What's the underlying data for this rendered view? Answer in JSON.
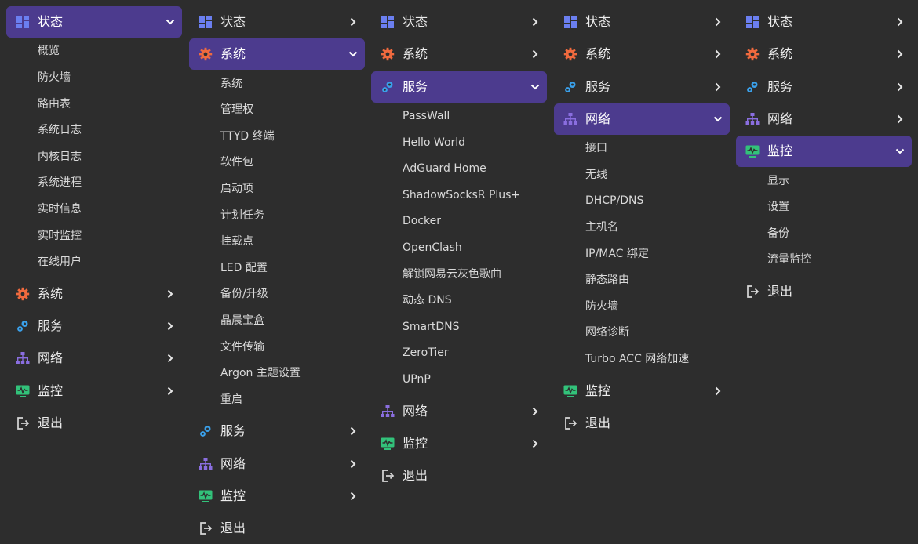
{
  "colors": {
    "background": "#2d2d2d",
    "active": "#4c3b8e",
    "dashboard_icon": "#6b7ff0",
    "gear_icon": "#f06a3e",
    "service_icon": "#3aa0ea",
    "network_icon": "#8a6ee0",
    "monitor_icon": "#32c27a"
  },
  "icons": [
    "dashboard-icon",
    "gear-icon",
    "service-icon",
    "network-icon",
    "monitor-icon",
    "logout-icon",
    "chevron-right-icon",
    "chevron-down-icon"
  ],
  "columns": [
    {
      "status": "状态",
      "system": "系统",
      "service": "服务",
      "network": "网络",
      "monitor": "监控",
      "logout": "退出",
      "expanded": "status",
      "submenu": [
        "概览",
        "防火墙",
        "路由表",
        "系统日志",
        "内核日志",
        "系统进程",
        "实时信息",
        "实时监控",
        "在线用户"
      ]
    },
    {
      "status": "状态",
      "system": "系统",
      "service": "服务",
      "network": "网络",
      "monitor": "监控",
      "logout": "退出",
      "expanded": "system",
      "submenu": [
        "系统",
        "管理权",
        "TTYD 终端",
        "软件包",
        "启动项",
        "计划任务",
        "挂载点",
        "LED 配置",
        "备份/升级",
        "晶晨宝盒",
        "文件传输",
        "Argon 主题设置",
        "重启"
      ]
    },
    {
      "status": "状态",
      "system": "系统",
      "service": "服务",
      "network": "网络",
      "monitor": "监控",
      "logout": "退出",
      "expanded": "service",
      "submenu": [
        "PassWall",
        "Hello World",
        "AdGuard Home",
        "ShadowSocksR Plus+",
        "Docker",
        "OpenClash",
        "解锁网易云灰色歌曲",
        "动态 DNS",
        "SmartDNS",
        "ZeroTier",
        "UPnP"
      ]
    },
    {
      "status": "状态",
      "system": "系统",
      "service": "服务",
      "network": "网络",
      "monitor": "监控",
      "logout": "退出",
      "expanded": "network",
      "submenu": [
        "接口",
        "无线",
        "DHCP/DNS",
        "主机名",
        "IP/MAC 绑定",
        "静态路由",
        "防火墙",
        "网络诊断",
        "Turbo ACC 网络加速"
      ]
    },
    {
      "status": "状态",
      "system": "系统",
      "service": "服务",
      "network": "网络",
      "monitor": "监控",
      "logout": "退出",
      "expanded": "monitor",
      "submenu": [
        "显示",
        "设置",
        "备份",
        "流量监控"
      ]
    }
  ]
}
